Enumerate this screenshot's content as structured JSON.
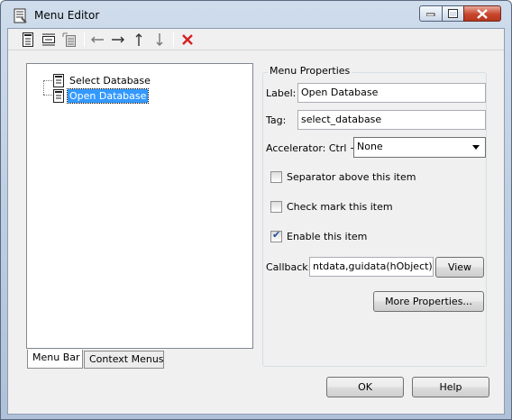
{
  "window": {
    "title": "Menu Editor"
  },
  "toolbar": {
    "buttons": [
      {
        "icon": "new-menu-icon"
      },
      {
        "icon": "new-menu-item-icon"
      },
      {
        "icon": "new-context-menu-icon"
      },
      {
        "icon": "move-backward-icon"
      },
      {
        "icon": "move-forward-icon"
      },
      {
        "icon": "move-up-icon"
      },
      {
        "icon": "move-down-icon"
      },
      {
        "icon": "delete-icon"
      }
    ]
  },
  "tree": {
    "items": [
      {
        "label": "Select Database"
      },
      {
        "label": "Open Database"
      }
    ]
  },
  "tabs": {
    "menu_bar": "Menu Bar",
    "context_menus": "Context Menus"
  },
  "properties": {
    "group_title": "Menu Properties",
    "label_caption": "Label:",
    "label_value": "Open Database",
    "tag_caption": "Tag:",
    "tag_value": "select_database",
    "accelerator_caption": "Accelerator: Ctrl +",
    "accelerator_value": "None",
    "separator_label": "Separator above this item",
    "separator_checked": false,
    "checkmark_label": "Check mark this item",
    "checkmark_checked": false,
    "enable_label": "Enable this item",
    "enable_checked": true,
    "callback_caption": "Callback:",
    "callback_value": "ntdata,guidata(hObject))",
    "view_button": "View",
    "more_properties_button": "More Properties..."
  },
  "footer": {
    "ok_button": "OK",
    "help_button": "Help"
  },
  "colors": {
    "selection": "#3399ff",
    "delete_red": "#d42020",
    "title_gradient_top": "#cfdcec"
  }
}
